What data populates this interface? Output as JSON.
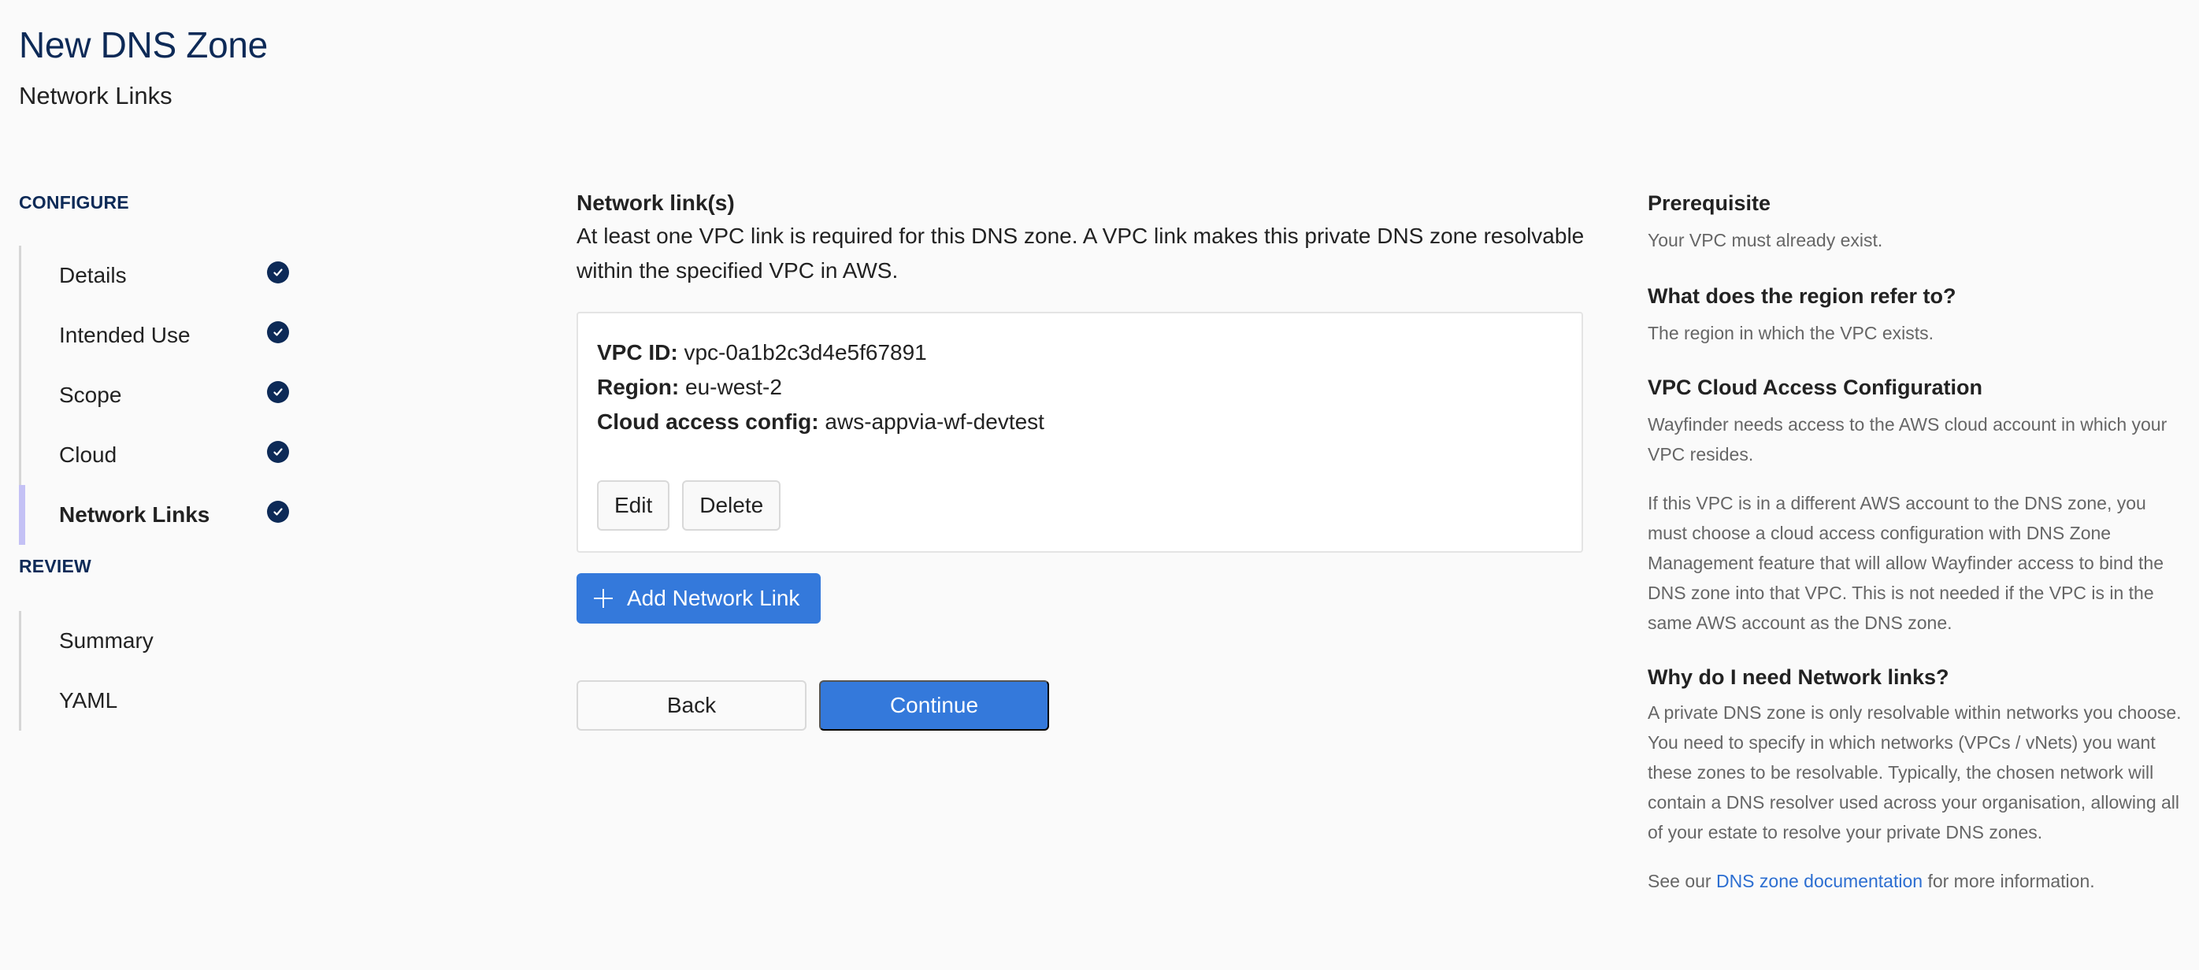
{
  "header": {
    "title": "New DNS Zone",
    "subtitle": "Network Links"
  },
  "sidebar": {
    "configure_label": "CONFIGURE",
    "configure_items": [
      {
        "label": "Details",
        "status": "complete",
        "icon": "check-circle-icon"
      },
      {
        "label": "Intended Use",
        "status": "complete",
        "icon": "check-circle-icon"
      },
      {
        "label": "Scope",
        "status": "complete",
        "icon": "check-circle-icon"
      },
      {
        "label": "Cloud",
        "status": "complete",
        "icon": "check-circle-icon"
      },
      {
        "label": "Network Links",
        "status": "complete",
        "icon": "check-circle-icon",
        "active": true
      }
    ],
    "review_label": "REVIEW",
    "review_items": [
      {
        "label": "Summary"
      },
      {
        "label": "YAML"
      }
    ]
  },
  "main": {
    "heading": "Network link(s)",
    "description": "At least one VPC link is required for this DNS zone. A VPC link makes this private DNS zone resolvable within the specified VPC in AWS.",
    "links": [
      {
        "vpc_id_label": "VPC ID:",
        "vpc_id": "vpc-0a1b2c3d4e5f67891",
        "region_label": "Region:",
        "region": "eu-west-2",
        "cloud_access_label": "Cloud access config:",
        "cloud_access": "aws-appvia-wf-devtest",
        "edit_label": "Edit",
        "delete_label": "Delete"
      }
    ],
    "add_label": "Add Network Link",
    "back_label": "Back",
    "continue_label": "Continue"
  },
  "help": {
    "prereq_heading": "Prerequisite",
    "prereq_text": "Your VPC must already exist.",
    "region_heading": "What does the region refer to?",
    "region_text": "The region in which the VPC exists.",
    "cloud_heading": "VPC Cloud Access Configuration",
    "cloud_text_1": "Wayfinder needs access to the AWS cloud account in which your VPC resides.",
    "cloud_text_2": "If this VPC is in a different AWS account to the DNS zone, you must choose a cloud access configuration with DNS Zone Management feature that will allow Wayfinder access to bind the DNS zone into that VPC. This is not needed if the VPC is in the same AWS account as the DNS zone.",
    "why_heading": "Why do I need Network links?",
    "why_text": "A private DNS zone is only resolvable within networks you choose. You need to specify in which networks (VPCs / vNets) you want these zones to be resolvable. Typically, the chosen network will contain a DNS resolver used across your organisation, allowing all of your estate to resolve your private DNS zones.",
    "see_prefix": "See our",
    "see_link": "DNS zone documentation",
    "see_suffix": "for more information."
  },
  "colors": {
    "brand_navy": "#0d2a57",
    "primary_blue": "#3479db",
    "link_blue": "#2c6ed1",
    "active_step_bar": "#c4c1f5",
    "background": "#fafafa"
  }
}
